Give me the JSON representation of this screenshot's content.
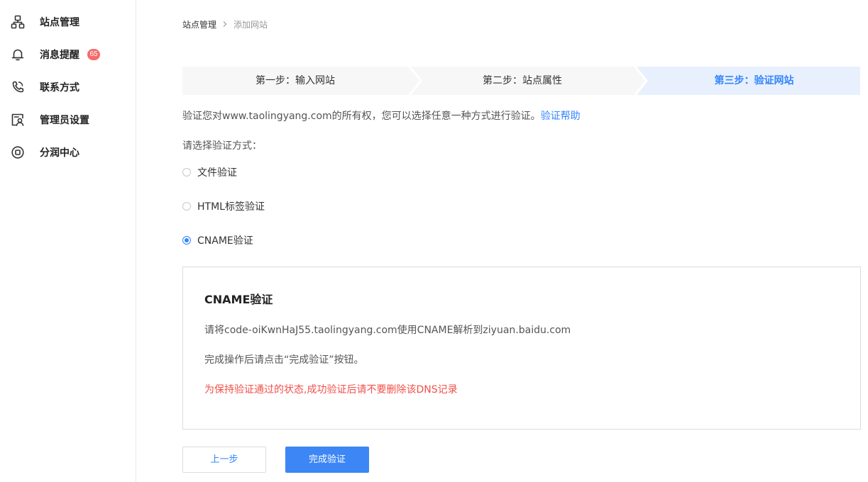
{
  "sidebar": {
    "items": [
      {
        "label": "站点管理",
        "icon": "site-tree-icon"
      },
      {
        "label": "消息提醒",
        "icon": "bell-icon",
        "badge": "65"
      },
      {
        "label": "联系方式",
        "icon": "phone-icon"
      },
      {
        "label": "管理员设置",
        "icon": "admin-user-icon"
      },
      {
        "label": "分润中心",
        "icon": "revenue-share-icon"
      }
    ]
  },
  "breadcrumb": {
    "root": "站点管理",
    "separator": ">",
    "current": "添加网站"
  },
  "steps": [
    {
      "label": "第一步：输入网站",
      "active": false
    },
    {
      "label": "第二步：站点属性",
      "active": false
    },
    {
      "label": "第三步：验证网站",
      "active": true
    }
  ],
  "verify": {
    "description": "验证您对www.taolingyang.com的所有权，您可以选择任意一种方式进行验证。",
    "help_link": "验证帮助",
    "method_title": "请选择验证方式：",
    "methods": [
      {
        "label": "文件验证",
        "checked": false
      },
      {
        "label": "HTML标签验证",
        "checked": false
      },
      {
        "label": "CNAME验证",
        "checked": true
      }
    ]
  },
  "panel": {
    "title": "CNAME验证",
    "instruction": "请将code-oiKwnHaJ55.taolingyang.com使用CNAME解析到ziyuan.baidu.com",
    "complete_hint": "完成操作后请点击“完成验证”按钮。",
    "warning": "为保持验证通过的状态,成功验证后请不要删除该DNS记录"
  },
  "buttons": {
    "prev": "上一步",
    "finish": "完成验证"
  },
  "colors": {
    "accent": "#3385ff",
    "warning": "#f0504a",
    "badge": "#f56c6c",
    "step_inactive_bg": "#f7f7f7",
    "step_active_bg": "#e8f0fd",
    "primary_button": "#3d86f5"
  }
}
